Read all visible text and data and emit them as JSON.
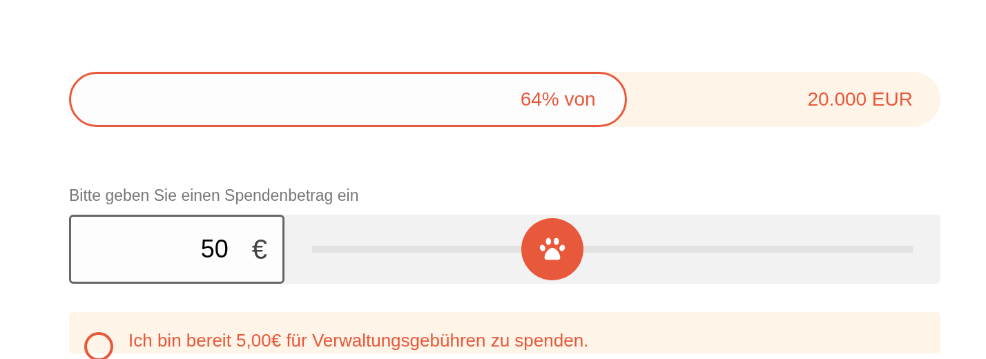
{
  "progress": {
    "level": 0.64,
    "label": "64% von",
    "goal": "20.000 EUR"
  },
  "amount": {
    "label": "Bitte geben Sie einen Spendenbetrag ein",
    "value": "50",
    "currency": "€",
    "slider": {
      "level": 0.4
    }
  },
  "fee_option": {
    "checked": false,
    "label": "Ich bin bereit 5,00€ für Verwaltungsgebühren zu spenden."
  }
}
